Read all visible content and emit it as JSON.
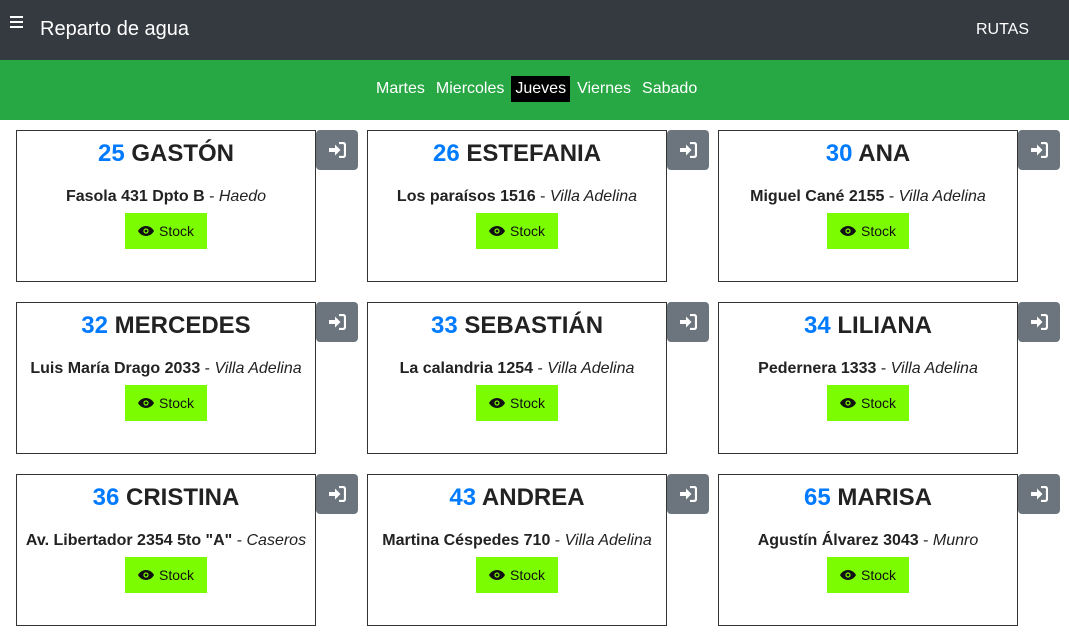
{
  "header": {
    "menu_icon": "hamburger-icon",
    "title": "Reparto de agua",
    "rutas_label": "RUTAS"
  },
  "days": [
    {
      "label": "Martes",
      "active": false
    },
    {
      "label": "Miercoles",
      "active": false
    },
    {
      "label": "Jueves",
      "active": true
    },
    {
      "label": "Viernes",
      "active": false
    },
    {
      "label": "Sabado",
      "active": false
    }
  ],
  "colors": {
    "navbar": "#343a40",
    "daybar": "#28a745",
    "number": "#007bff",
    "stock_button": "#7cfc00",
    "enter_button": "#6c757d"
  },
  "clients": [
    {
      "number": "25",
      "name": "GASTÓN",
      "street": "Fasola 431 Dpto B",
      "city": "Haedo",
      "button_label": "Stock"
    },
    {
      "number": "26",
      "name": "ESTEFANIA",
      "street": "Los paraísos 1516",
      "city": "Villa Adelina",
      "button_label": "Stock"
    },
    {
      "number": "30",
      "name": "ANA",
      "street": "Miguel Cané 2155",
      "city": "Villa Adelina",
      "button_label": "Stock"
    },
    {
      "number": "32",
      "name": "MERCEDES",
      "street": "Luis María Drago 2033",
      "city": "Villa Adelina",
      "button_label": "Stock"
    },
    {
      "number": "33",
      "name": "SEBASTIÁN",
      "street": "La calandria 1254",
      "city": "Villa Adelina",
      "button_label": "Stock"
    },
    {
      "number": "34",
      "name": "LILIANA",
      "street": "Pedernera 1333",
      "city": "Villa Adelina",
      "button_label": "Stock"
    },
    {
      "number": "36",
      "name": "CRISTINA",
      "street": "Av. Libertador 2354 5to \"A\"",
      "city": "Caseros",
      "button_label": "Stock"
    },
    {
      "number": "43",
      "name": "ANDREA",
      "street": "Martina Céspedes 710",
      "city": "Villa Adelina",
      "button_label": "Stock"
    },
    {
      "number": "65",
      "name": "MARISA",
      "street": "Agustín Álvarez 3043",
      "city": "Munro",
      "button_label": "Stock"
    }
  ],
  "separator": " - ",
  "icons": {
    "stock": "eye-icon",
    "enter": "sign-in-icon"
  }
}
